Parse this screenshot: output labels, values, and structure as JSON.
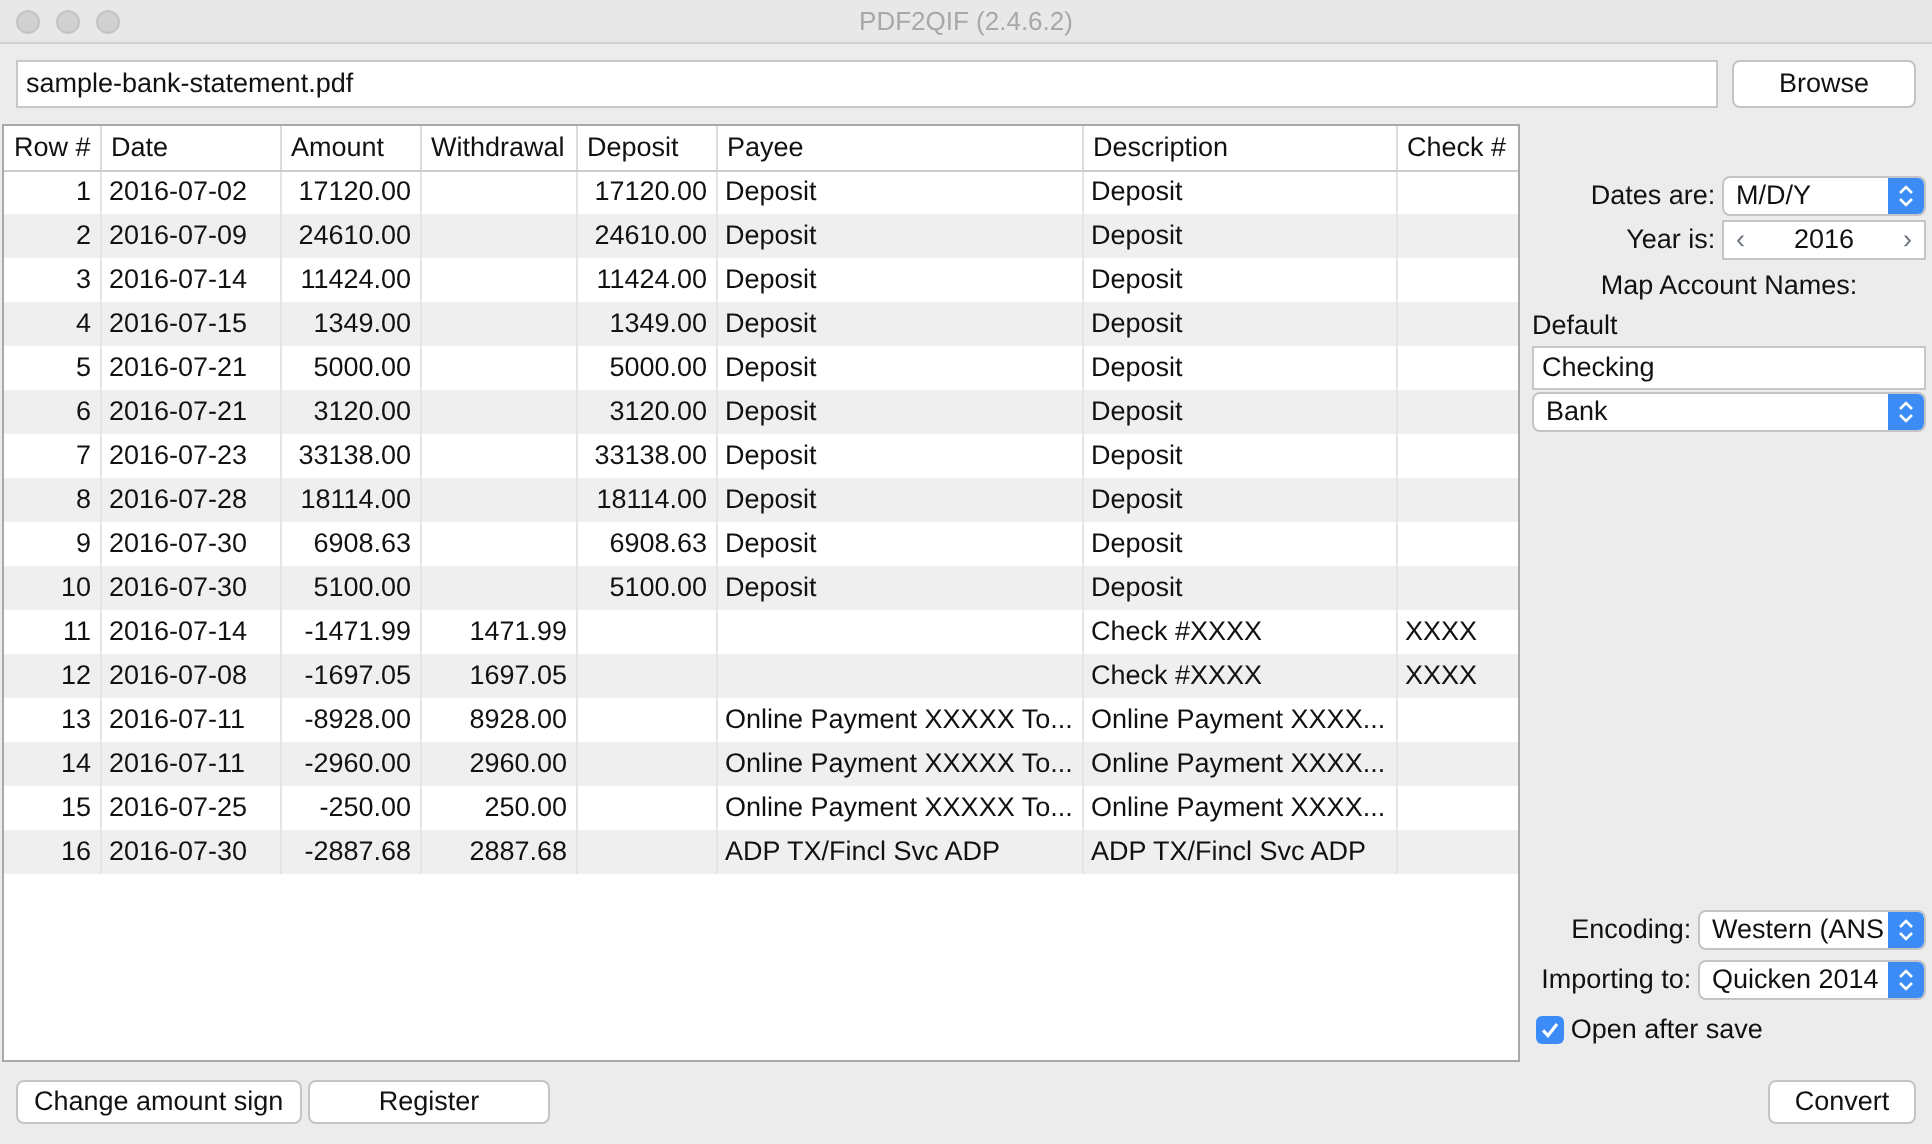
{
  "window": {
    "title": "PDF2QIF (2.4.6.2)"
  },
  "file": {
    "value": "sample-bank-statement.pdf",
    "browse": "Browse"
  },
  "table": {
    "columns": [
      "Row #",
      "Date",
      "Amount",
      "Withdrawal",
      "Deposit",
      "Payee",
      "Description",
      "Check #"
    ],
    "rows": [
      [
        "1",
        "2016-07-02",
        "17120.00",
        "",
        "17120.00",
        "Deposit",
        "Deposit",
        ""
      ],
      [
        "2",
        "2016-07-09",
        "24610.00",
        "",
        "24610.00",
        "Deposit",
        "Deposit",
        ""
      ],
      [
        "3",
        "2016-07-14",
        "11424.00",
        "",
        "11424.00",
        "Deposit",
        "Deposit",
        ""
      ],
      [
        "4",
        "2016-07-15",
        "1349.00",
        "",
        "1349.00",
        "Deposit",
        "Deposit",
        ""
      ],
      [
        "5",
        "2016-07-21",
        "5000.00",
        "",
        "5000.00",
        "Deposit",
        "Deposit",
        ""
      ],
      [
        "6",
        "2016-07-21",
        "3120.00",
        "",
        "3120.00",
        "Deposit",
        "Deposit",
        ""
      ],
      [
        "7",
        "2016-07-23",
        "33138.00",
        "",
        "33138.00",
        "Deposit",
        "Deposit",
        ""
      ],
      [
        "8",
        "2016-07-28",
        "18114.00",
        "",
        "18114.00",
        "Deposit",
        "Deposit",
        ""
      ],
      [
        "9",
        "2016-07-30",
        "6908.63",
        "",
        "6908.63",
        "Deposit",
        "Deposit",
        ""
      ],
      [
        "10",
        "2016-07-30",
        "5100.00",
        "",
        "5100.00",
        "Deposit",
        "Deposit",
        ""
      ],
      [
        "11",
        "2016-07-14",
        "-1471.99",
        "1471.99",
        "",
        "",
        "Check #XXXX",
        "XXXX"
      ],
      [
        "12",
        "2016-07-08",
        "-1697.05",
        "1697.05",
        "",
        "",
        "Check #XXXX",
        "XXXX"
      ],
      [
        "13",
        "2016-07-11",
        "-8928.00",
        "8928.00",
        "",
        "Online Payment XXXXX To...",
        "Online Payment XXXX...",
        ""
      ],
      [
        "14",
        "2016-07-11",
        "-2960.00",
        "2960.00",
        "",
        "Online Payment XXXXX To...",
        "Online Payment XXXX...",
        ""
      ],
      [
        "15",
        "2016-07-25",
        "-250.00",
        "250.00",
        "",
        "Online Payment XXXXX To...",
        "Online Payment XXXX...",
        ""
      ],
      [
        "16",
        "2016-07-30",
        "-2887.68",
        "2887.68",
        "",
        "ADP TX/Fincl Svc ADP",
        "ADP TX/Fincl Svc ADP",
        ""
      ]
    ]
  },
  "settings": {
    "dates_label": "Dates are:",
    "dates_value": "M/D/Y",
    "year_label": "Year is:",
    "year_prev": "‹",
    "year_value": "2016",
    "year_next": "›",
    "map_label": "Map Account Names:",
    "default_label": "Default",
    "account_name": "Checking",
    "account_type": "Bank",
    "encoding_label": "Encoding:",
    "encoding_value": "Western (ANS",
    "importing_label": "Importing to:",
    "importing_value": "Quicken 2014",
    "open_after_save": {
      "label": "Open after save",
      "checked": true
    }
  },
  "buttons": {
    "change_sign": "Change amount sign",
    "register": "Register",
    "convert": "Convert"
  }
}
